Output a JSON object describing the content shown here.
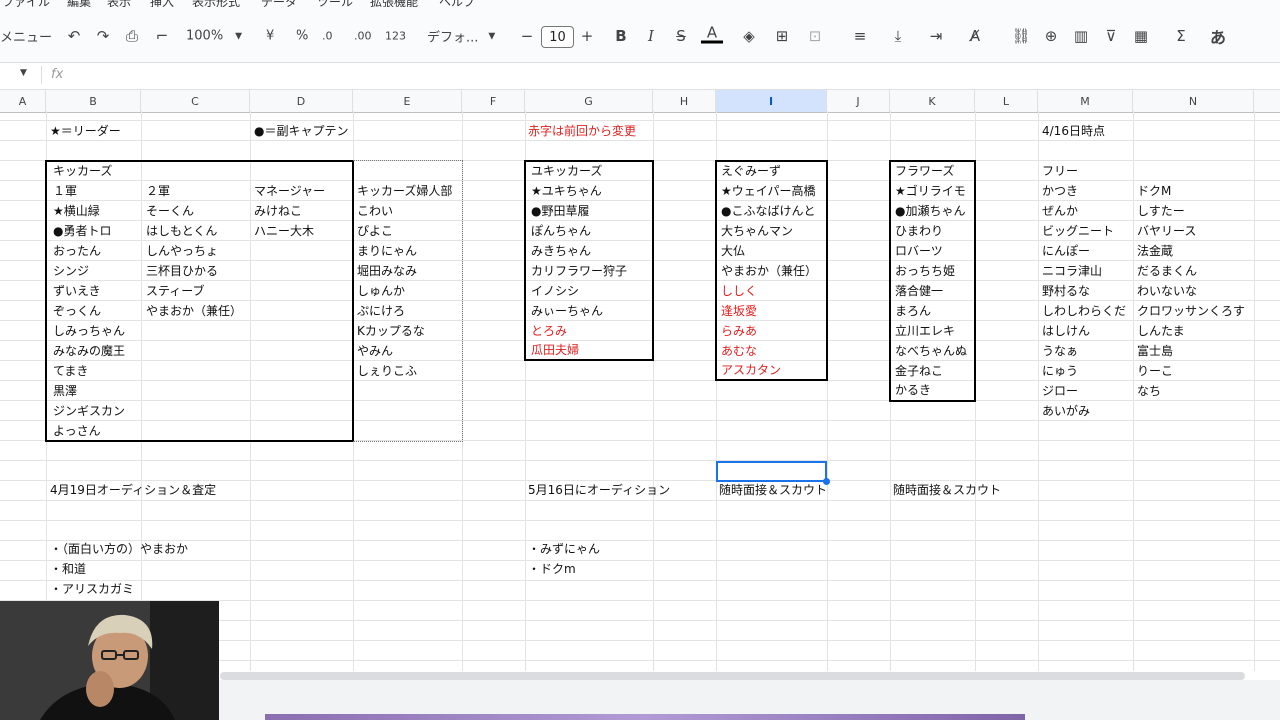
{
  "menu": [
    "ファイル",
    "編集",
    "表示",
    "挿入",
    "表示形式",
    "データ",
    "ツール",
    "拡張機能",
    "ヘルプ"
  ],
  "toolbar": {
    "menu_label": "メニュー",
    "zoom": "100%",
    "currency": "¥",
    "percent": "%",
    "dec_decrease": ".0",
    "dec_increase": ".00",
    "num_format": "123",
    "font": "デフォ...",
    "font_size": "10",
    "bold": "B",
    "italic": "I",
    "strike": "S",
    "text_color": "A",
    "sum": "Σ",
    "input_mode": "あ"
  },
  "formula": {
    "fx": "fx",
    "value": ""
  },
  "columns": [
    "A",
    "B",
    "C",
    "D",
    "E",
    "F",
    "G",
    "H",
    "I",
    "J",
    "K",
    "L",
    "M",
    "N"
  ],
  "selected_column": "I",
  "headers": {
    "legend_star": "★＝リーダー",
    "legend_dot": "●＝副キャプテン",
    "changes_note": "赤字は前回から変更",
    "date_note": "4/16日時点"
  },
  "kickers": {
    "team": "キッカーズ",
    "col1_title": "１軍",
    "col2_title": "２軍",
    "col3_title": "マネージャー",
    "col1": [
      "★横山緑",
      "●勇者トロ",
      "おったん",
      "シンジ",
      "ずいえき",
      "ぞっくん",
      "しみっちゃん",
      "みなみの魔王",
      "てまき",
      "黒澤",
      "ジンギスカン",
      "よっさん"
    ],
    "col2": [
      "そーくん",
      "はしもとくん",
      "しんやっちょ",
      "三杯目ひかる",
      "スティーブ",
      "やまおか（兼任）"
    ],
    "col3": [
      "みけねこ",
      "ハニー大木"
    ]
  },
  "womens": {
    "title": "キッカーズ婦人部",
    "members": [
      "こわい",
      "ぴよこ",
      "まりにゃん",
      "堀田みなみ",
      "しゅんか",
      "ぷにけろ",
      "Kカップるな",
      "やみん",
      "しぇりこふ"
    ]
  },
  "yukikickers": {
    "team": "ユキッカーズ",
    "members": [
      "★ユキちゃん",
      "●野田草履",
      "ぽんちゃん",
      "みきちゃん",
      "カリフラワー狩子",
      "イノシシ",
      "みぃーちゃん"
    ],
    "red_members": [
      "とろみ",
      "瓜田夫婦"
    ]
  },
  "egumizu": {
    "team": "えぐみーず",
    "members": [
      "★ウェイパー高橋",
      "●こふなばけんと",
      "大ちゃんマン",
      "大仏",
      "やまおか（兼任）"
    ],
    "red_members": [
      "ししく",
      "逢坂愛",
      "らみあ",
      "あむな",
      "アスカタン"
    ]
  },
  "flowers": {
    "team": "フラワーズ",
    "members": [
      "★ゴリライモ",
      "●加瀬ちゃん",
      "ひまわり",
      "ロバーツ",
      "おっちち姫",
      "落合健一",
      "まろん",
      "立川エレキ",
      "なべちゃんぬ",
      "金子ねこ",
      "かるき"
    ]
  },
  "free": {
    "title": "フリー",
    "col_m": [
      "かつき",
      "ぜんか",
      "ビッグニート",
      "にんぽー",
      "ニコラ津山",
      "野村るな",
      "しわしわらくだ",
      "はしけん",
      "うなぁ",
      "にゅう",
      "ジロー",
      "あいがみ"
    ],
    "col_n": [
      "ドクM",
      "しすたー",
      "バヤリース",
      "法金蔵",
      "だるまくん",
      "わいないな",
      "クロワッサンくろす",
      "しんたま",
      "富士島",
      "りーこ",
      "なち"
    ]
  },
  "notes": {
    "audition1": "4月19日オーディション＆査定",
    "audition1_items": [
      "・（面白い方の）やまおか",
      "・和道",
      "・アリスカガミ"
    ],
    "audition2": "5月16日にオーディション",
    "audition2_items": [
      "・みずにゃん",
      "・ドクm"
    ],
    "interview1": "随時面接＆スカウト",
    "interview2": "随時面接＆スカウト"
  }
}
